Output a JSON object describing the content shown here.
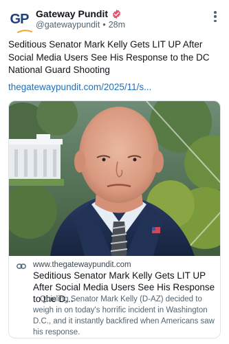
{
  "post": {
    "author": {
      "name": "Gateway Pundit",
      "handle": "@gatewaypundit",
      "separator": "•",
      "time": "28m",
      "avatar_text_g": "G",
      "avatar_text_p": "P"
    },
    "text": "Seditious Senator Mark Kelly Gets LIT UP After Social Media Users See His Response to the DC National Guard Shooting",
    "link_text": "thegatewaypundit.com/2025/11/s..."
  },
  "link_card": {
    "domain": "www.thegatewaypundit.com",
    "title": "Seditious Senator Mark Kelly Gets LIT UP After Social Media Users See His Response to the D...",
    "description": "Quisling Senator Mark Kelly (D-AZ) decided to weigh in on today's horrific incident in Washington D.C., and it instantly backfired when Americans saw his response."
  },
  "colors": {
    "verified_badge": "#e8526a",
    "link": "#1d6fb8",
    "brand_navy": "#1f3f7a",
    "brand_orange": "#f2a42b",
    "muted": "#536471"
  },
  "icons": {
    "verified": "verified-badge-icon",
    "more": "more-vertical-icon",
    "link": "link-chain-icon"
  }
}
